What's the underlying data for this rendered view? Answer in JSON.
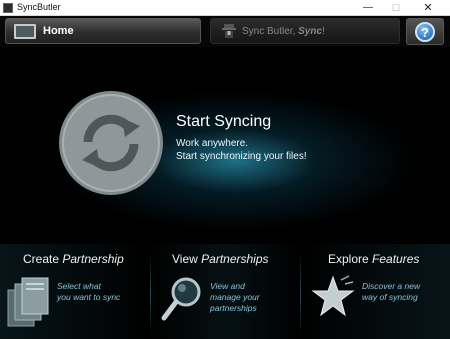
{
  "window": {
    "title": "SyncButler",
    "minimize_glyph": "—",
    "maximize_glyph": "☐",
    "close_glyph": "✕"
  },
  "topbar": {
    "home_tab": {
      "label": "Home",
      "icon": "monitor-icon"
    },
    "sync_tab": {
      "label_prefix": "Sync Butler,",
      "label_emphasis": "Sync",
      "label_suffix": "!",
      "icon": "butler-icon"
    },
    "help_button": {
      "label": "?",
      "icon": "help-icon"
    }
  },
  "hero": {
    "title": "Start Syncing",
    "subtitle_line1": "Work anywhere.",
    "subtitle_line2": "Start synchronizing your files!",
    "icon": "sync-arrows-icon"
  },
  "panels": {
    "create": {
      "title_plain": "Create",
      "title_emphasis": "Partnership",
      "desc_line1": "Select what",
      "desc_line2": "you want to sync",
      "icon": "documents-icon"
    },
    "view": {
      "title_plain": "View",
      "title_emphasis": "Partnerships",
      "desc_line1": "View and",
      "desc_line2": "manage your",
      "desc_line3": "partnerships",
      "icon": "magnifier-icon"
    },
    "explore": {
      "title_plain": "Explore",
      "title_emphasis": "Features",
      "desc_line1": "Discover a new",
      "desc_line2": "way of syncing",
      "icon": "star-icon"
    }
  },
  "colors": {
    "background": "#000000",
    "accent_glow": "#2896b4",
    "description_text": "#88c4dc",
    "help_blue": "#2f78c3"
  }
}
